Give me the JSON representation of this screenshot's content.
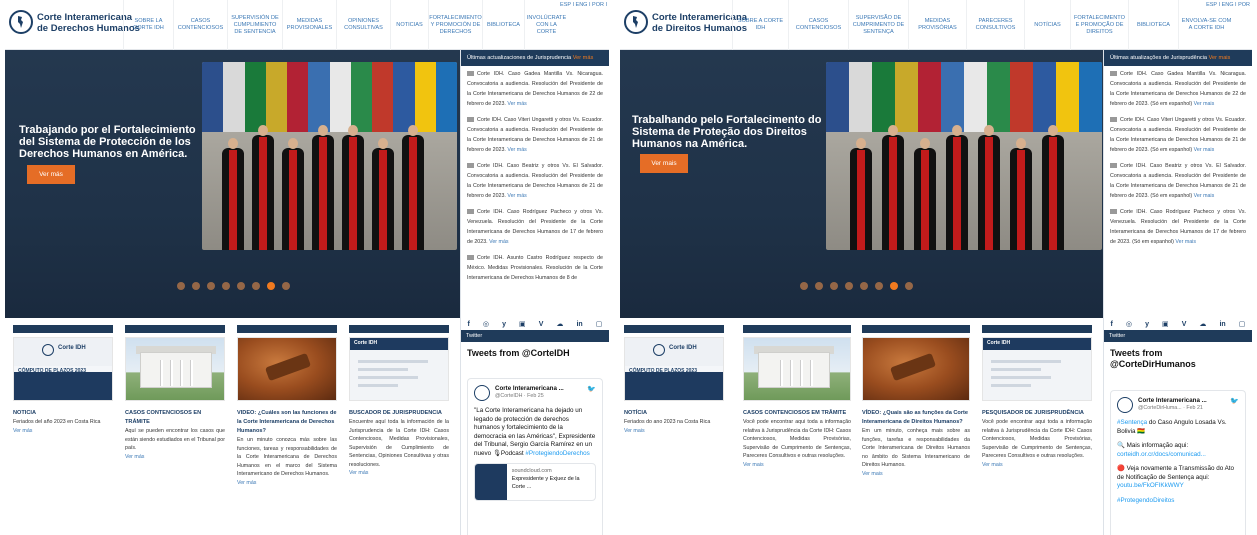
{
  "left": {
    "logo": {
      "line1": "Corte Interamericana",
      "line2": "de Derechos Humanos"
    },
    "nav": [
      "SOBRE LA CORTE IDH",
      "CASOS CONTENCIOSOS",
      "SUPERVISIÓN DE CUMPLIMIENTO DE SENTENCIA",
      "MEDIDAS PROVISIONALES",
      "OPINIONES CONSULTIVAS",
      "NOTICIAS",
      "FORTALECIMIENTO Y PROMOCIÓN DE DERECHOS",
      "BIBLIOTECA",
      "INVOLÚCRATE CON LA CORTE"
    ],
    "lang": "ESP I ENG I POR I",
    "hero": {
      "title": "Trabajando por el Fortalecimiento del Sistema de Protección de los Derechos Humanos en América.",
      "button": "Ver más"
    },
    "news": {
      "header": "Últimas actualizaciones de Jurisprudencia",
      "header_more": "Ver más",
      "items": [
        {
          "text": "Corte IDH. Caso Gadea Mantilla Vs. Nicaragua. Convocatoria a audiencia. Resolución del Presidente de la Corte Interamericana de Derechos Humanos de 22 de febrero de 2023.",
          "more": "Ver más"
        },
        {
          "text": "Corte IDH. Caso Viteri Ungaretti y otros Vs. Ecuador. Convocatoria a audiencia. Resolución del Presidente de la Corte Interamericana de Derechos Humanos de 21 de febrero de 2023.",
          "more": "Ver más"
        },
        {
          "text": "Corte IDH. Caso Beatriz y otros Vs. El Salvador. Convocatoria a audiencia. Resolución del Presidente de la Corte Interamericana de Derechos Humanos de 21 de febrero de 2023.",
          "more": "Ver más"
        },
        {
          "text": "Corte IDH. Caso Rodríguez Pacheco y otros Vs. Venezuela. Resolución del Presidente de la Corte Interamericana de Derechos Humanos de 17 de febrero de 2023.",
          "more": "Ver más"
        },
        {
          "text": "Corte IDH. Asunto Castro Rodríguez respecto de México. Medidas Provisionales. Resolución de la Corte Interamericana de Derechos Humanos de 8 de",
          "more": ""
        }
      ]
    },
    "cards": [
      {
        "title": "NOTICIA",
        "text": "Feriados del año 2023 en Costa Rica",
        "more": "Ver más"
      },
      {
        "title": "CASOS CONTENCIOSOS EN TRÁMITE",
        "text": "Aquí se pueden encontrar los casos que están siendo estudiados en el Tribunal por país.",
        "more": "Ver más"
      },
      {
        "title": "VIDEO: ¿Cuáles son las funciones de la Corte Interamericana de Derechos Humanos?",
        "text": "En un minuto conozca más sobre las funciones, tareas y responsabilidades de la Corte Interamericana de Derechos Humanos en el marco del Sistema Interamericano de Derechos Humanos.",
        "more": "Ver más"
      },
      {
        "title": "BUSCADOR DE JURISPRUDENCIA",
        "text": "Encuentre aquí toda la información de la Jurisprudencia de la Corte IDH: Casos Contenciosos, Medidas Provisionales, Supervisión de Cumplimiento de Sentencias, Opiniones Consultivas y otras resoluciones.",
        "more": "Ver más"
      }
    ],
    "twitter": {
      "label": "Twitter",
      "title": "Tweets from @CorteIDH",
      "author": "Corte Interamericana ...",
      "handle": "@CorteIDH · Feb 25",
      "text": "\"La Corte Interamericana ha dejado un legado de protección de derechos humanos y fortalecimiento de la democracia en las Américas\", Expresidente del Tribunal, Sergio García Ramírez en un nuevo 🎙Podcast",
      "hashtag": "#ProtegiendoDerechos",
      "card_domain": "soundcloud.com",
      "card_title": "Expresidente y Exjuez de la Corte ..."
    },
    "card_calendar": {
      "brand": "Corte IDH",
      "tag": "CÓMPUTO DE PLAZOS 2023"
    },
    "card_screen": {
      "brand": "Corte IDH"
    }
  },
  "right": {
    "logo": {
      "line1": "Corte Interamericana",
      "line2": "de Direitos Humanos"
    },
    "nav": [
      "SOBRE A CORTE IDH",
      "CASOS CONTENCIOSOS",
      "SUPERVISÃO DE CUMPRIMENTO DE SENTENÇA",
      "MEDIDAS PROVISÓRIAS",
      "PARECERES CONSULTIVOS",
      "NOTÍCIAS",
      "FORTALECIMENTO E PROMOÇÃO DE DIREITOS",
      "BIBLIOTECA",
      "ENVOLVA-SE COM A CORTE IDH"
    ],
    "lang": "ESP I ENG I POR",
    "hero": {
      "title": "Trabalhando pelo Fortalecimento do Sistema de Proteção dos Direitos Humanos na América.",
      "button": "Ver mais"
    },
    "news": {
      "header": "Últimas atualizações de Jurisprudência",
      "header_more": "Ver mais",
      "items": [
        {
          "text": "Corte IDH. Caso Gadea Mantilla Vs. Nicaragua. Convocatoria a audiencia. Resolución del Presidente de la Corte Interamericana de Derechos Humanos de 22 de febrero de 2023. (Só em espanhol)",
          "more": "Ver mais"
        },
        {
          "text": "Corte IDH. Caso Viteri Ungaretti y otros Vs. Ecuador. Convocatoria a audiencia. Resolución del Presidente de la Corte Interamericana de Derechos Humanos de 21 de febrero de 2023. (Só em espanhol)",
          "more": "Ver mais"
        },
        {
          "text": "Corte IDH. Caso Beatriz y otros Vs. El Salvador. Convocatoria a audiencia. Resolución del Presidente de la Corte Interamericana de Derechos Humanos de 21 de febrero de 2023. (Só em espanhol)",
          "more": "Ver mais"
        },
        {
          "text": "Corte IDH. Caso Rodríguez Pacheco y otros Vs. Venezuela. Resolución del Presidente de la Corte Interamericana de Derechos Humanos de 17 de febrero de 2023. (Só em espanhol)",
          "more": "Ver mais"
        }
      ]
    },
    "cards": [
      {
        "title": "NOTÍCIA",
        "text": "Feriados do ano 2023 na Costa Rica",
        "more": "Ver mais"
      },
      {
        "title": "CASOS CONTENCIOSOS EM TRÂMITE",
        "text": "Você pode encontrar aqui toda a informação relativa à Jurisprudência da Corte IDH: Casos Contenciosos, Medidas Provisórias, Supervisão de Cumprimento de Sentenças, Pareceres Consultivos e outras resoluções.",
        "more": "Ver mais"
      },
      {
        "title": "VÍDEO: ¿Quais são as funções da Corte Interamericana de Direitos Humanos?",
        "text": "Em um minuto, conheça mais sobre as funções, tarefas e responsabilidades da Corte Interamericana de Direitos Humanos no âmbito do Sistema Interamericano de Direitos Humanos.",
        "more": "Ver mais"
      },
      {
        "title": "PESQUISADOR DE JURISPRUDÊNCIA",
        "text": "Você pode encontrar aqui toda a informação relativa à Jurisprudência da Corte IDH: Casos Contenciosos, Medidas Provisórias, Supervisão de Cumprimento de Sentenças, Pareceres Consultivos e outras resoluções.",
        "more": "Ver mais"
      }
    ],
    "twitter": {
      "label": "Twitter",
      "title": "Tweets from @CorteDirHumanos",
      "author": "Corte Interamericana ...",
      "handle": "@CorteDirHuma... · Feb 21",
      "text1_hash": "#Sentença",
      "text1": " do Caso Angulo Losada Vs. Bolivia 🇧🇴",
      "text2": "🔍 Mais informação aqui:",
      "link2": "corteidh.or.cr/docs/comunicad...",
      "text3": "🔴 Veja novamente a Transmissão do Ato de Notificação de Sentença aqui:",
      "link3": "youtu.be/FkOFIKkWWY",
      "hashtag": "#ProtegendoDireitos"
    },
    "card_calendar": {
      "brand": "Corte IDH",
      "tag": "CÓMPUTO DE PLAZOS 2023"
    },
    "card_screen": {
      "brand": "Corte IDH"
    }
  },
  "social_icons": [
    "f",
    "◎",
    "y",
    "▣",
    "V",
    "☁",
    "in",
    "▢"
  ],
  "colors": {
    "navy": "#1f3b5a",
    "orange": "#e56d26",
    "link": "#3b78b5"
  }
}
